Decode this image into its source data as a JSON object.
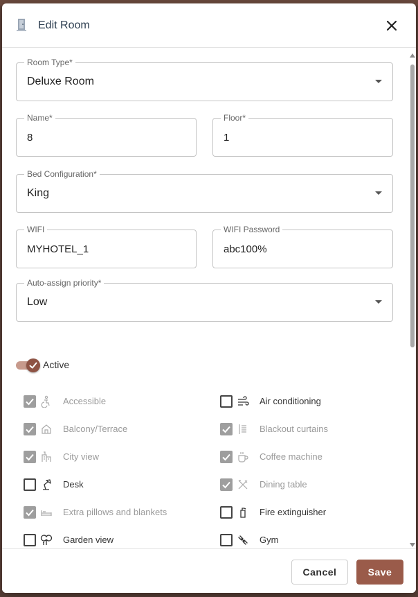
{
  "dialog": {
    "title": "Edit Room",
    "close_icon": "close-icon",
    "title_icon": "door-icon"
  },
  "form": {
    "room_type": {
      "label": "Room Type*",
      "value": "Deluxe Room"
    },
    "name": {
      "label": "Name*",
      "value": "8"
    },
    "floor": {
      "label": "Floor*",
      "value": "1"
    },
    "bed_configuration": {
      "label": "Bed Configuration*",
      "value": "King"
    },
    "wifi": {
      "label": "WIFI",
      "value": "MYHOTEL_1"
    },
    "wifi_password": {
      "label": "WIFI Password",
      "value": "abc100%"
    },
    "auto_assign_priority": {
      "label": "Auto-assign priority*",
      "value": "Low"
    },
    "active": {
      "label": "Active",
      "on": true
    }
  },
  "amenities": [
    {
      "label": "Accessible",
      "checked": true,
      "icon": "accessible-icon"
    },
    {
      "label": "Air conditioning",
      "checked": false,
      "icon": "air-conditioning-icon"
    },
    {
      "label": "Balcony/Terrace",
      "checked": true,
      "icon": "balcony-icon"
    },
    {
      "label": "Blackout curtains",
      "checked": true,
      "icon": "curtains-icon"
    },
    {
      "label": "City view",
      "checked": true,
      "icon": "city-view-icon"
    },
    {
      "label": "Coffee machine",
      "checked": true,
      "icon": "coffee-icon"
    },
    {
      "label": "Desk",
      "checked": false,
      "icon": "desk-lamp-icon"
    },
    {
      "label": "Dining table",
      "checked": true,
      "icon": "dining-icon"
    },
    {
      "label": "Extra pillows and blankets",
      "checked": true,
      "icon": "bed-icon"
    },
    {
      "label": "Fire extinguisher",
      "checked": false,
      "icon": "fire-extinguisher-icon"
    },
    {
      "label": "Garden view",
      "checked": false,
      "icon": "garden-icon"
    },
    {
      "label": "Gym",
      "checked": false,
      "icon": "gym-icon"
    }
  ],
  "footer": {
    "cancel_label": "Cancel",
    "save_label": "Save"
  },
  "colors": {
    "accent": "#9a5b4a",
    "title": "#2d3e50"
  }
}
